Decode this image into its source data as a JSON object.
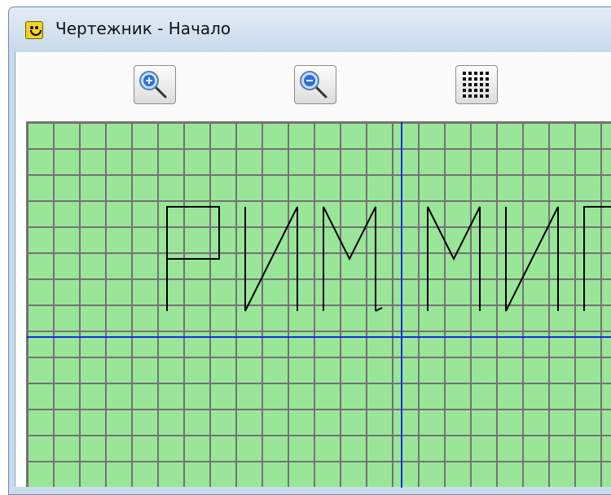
{
  "window": {
    "title": "Чертежник - Начало",
    "app_icon": "smiley-icon"
  },
  "toolbar": {
    "buttons": [
      {
        "name": "zoom-in",
        "icon": "magnifier-plus-icon"
      },
      {
        "name": "zoom-out",
        "icon": "magnifier-minus-icon"
      },
      {
        "name": "toggle-grid",
        "icon": "grid-dots-icon"
      }
    ]
  },
  "canvas": {
    "background_color": "#99e699",
    "grid_color": "#737373",
    "axis_color": "#1030e0",
    "pen_color": "#000000",
    "drawn_text": "РИМ, МИР"
  }
}
